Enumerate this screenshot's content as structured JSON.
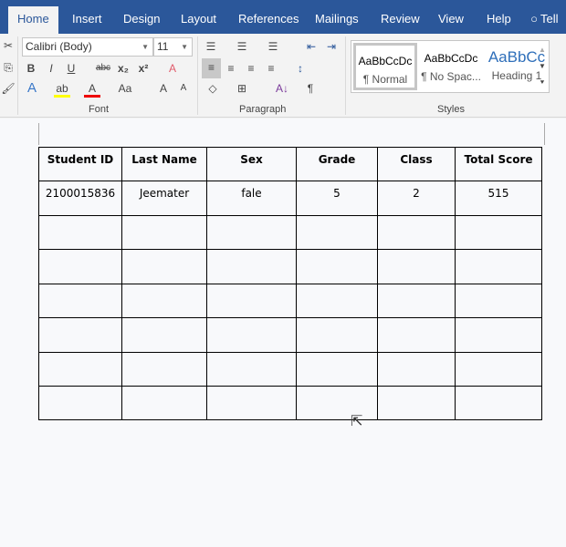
{
  "tabs": [
    "Home",
    "Insert",
    "Design",
    "Layout",
    "References",
    "Mailings",
    "Review",
    "View",
    "Help",
    "Tell"
  ],
  "font": {
    "name": "Calibri (Body)",
    "size": "11",
    "group": "Font"
  },
  "paragraph": {
    "group": "Paragraph"
  },
  "styles": {
    "group": "Styles",
    "items": [
      {
        "sample": "AaBbCcDc",
        "name": "¶ Normal"
      },
      {
        "sample": "AaBbCcDc",
        "name": "¶ No Spac..."
      },
      {
        "sample": "AaBbCc",
        "name": "Heading 1"
      }
    ]
  },
  "table": {
    "headers": [
      "Student ID",
      "Last Name",
      "Sex",
      "Grade",
      "Class",
      "Total Score"
    ],
    "rows": [
      [
        "2100015836",
        "Jeemater",
        "fale",
        "5",
        "2",
        "515"
      ],
      [
        "",
        "",
        "",
        "",
        "",
        ""
      ],
      [
        "",
        "",
        "",
        "",
        "",
        ""
      ],
      [
        "",
        "",
        "",
        "",
        "",
        ""
      ],
      [
        "",
        "",
        "",
        "",
        "",
        ""
      ],
      [
        "",
        "",
        "",
        "",
        "",
        ""
      ],
      [
        "",
        "",
        "",
        "",
        "",
        ""
      ]
    ]
  }
}
